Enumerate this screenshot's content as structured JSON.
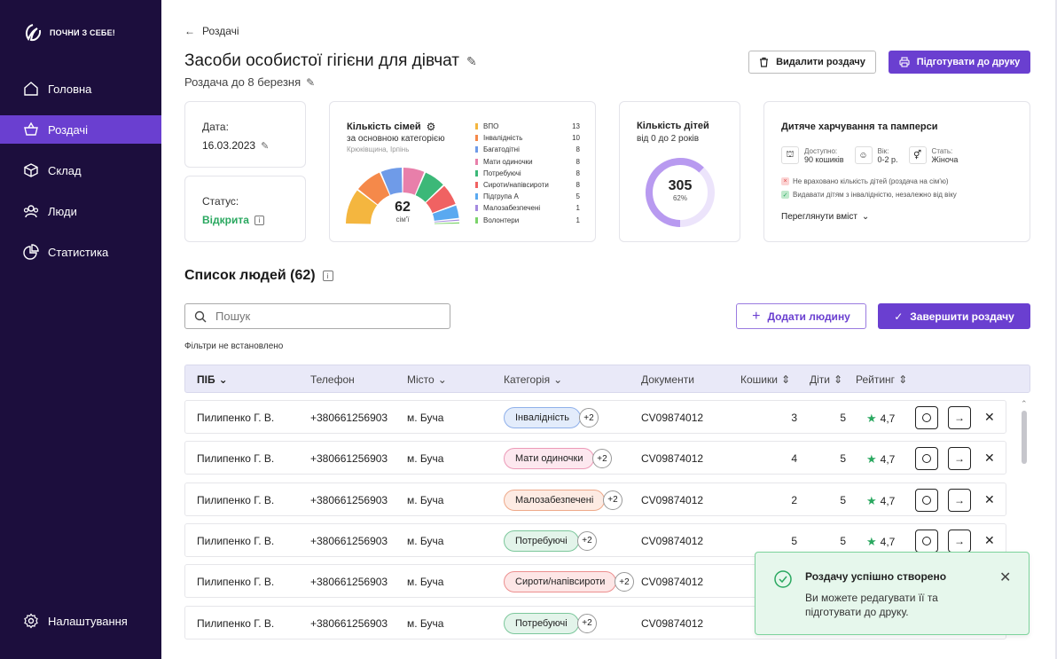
{
  "brand": "ПОЧНИ З СЕБЕ!",
  "nav": [
    {
      "label": "Головна",
      "icon": "home-icon"
    },
    {
      "label": "Роздачі",
      "icon": "basket-icon"
    },
    {
      "label": "Склад",
      "icon": "box-icon"
    },
    {
      "label": "Люди",
      "icon": "people-icon"
    },
    {
      "label": "Статистика",
      "icon": "pie-chart-icon"
    }
  ],
  "settings_label": "Налаштування",
  "back_label": "Роздачі",
  "title": "Засоби особистої гігієни для дівчат",
  "subtitle": "Роздача до 8 березня",
  "delete_label": "Видалити роздачу",
  "print_label": "Підготувати до друку",
  "date": {
    "label": "Дата:",
    "value": "16.03.2023"
  },
  "status": {
    "label": "Статус:",
    "value": "Відкрита"
  },
  "families": {
    "title": "Кількість сімей",
    "subtitle": "за основною категорією",
    "location": "Крюківщина, Ірпінь",
    "total": "62",
    "unit": "сім'ї",
    "legend": [
      {
        "name": "ВПО",
        "value": "13",
        "color": "#f4b63f"
      },
      {
        "name": "Інвалідність",
        "value": "10",
        "color": "#f5894a"
      },
      {
        "name": "Багатодітні",
        "value": "8",
        "color": "#6f9be8"
      },
      {
        "name": "Мати одиночки",
        "value": "8",
        "color": "#e87faa"
      },
      {
        "name": "Потребуючі",
        "value": "8",
        "color": "#3cb878"
      },
      {
        "name": "Сироти/напівсироти",
        "value": "8",
        "color": "#f06262"
      },
      {
        "name": "Підгрупа А",
        "value": "5",
        "color": "#5aa9f0"
      },
      {
        "name": "Малозабезпечені",
        "value": "1",
        "color": "#a58ae0"
      },
      {
        "name": "Волонтери",
        "value": "1",
        "color": "#7bd36a"
      }
    ]
  },
  "children": {
    "title": "Кількість дітей",
    "subtitle": "від 0 до 2 років",
    "value": "305",
    "percent": "62%",
    "fraction": 0.62
  },
  "baby": {
    "title": "Дитяче харчування та памперси",
    "available_label": "Доступно:",
    "available_value": "90 кошиків",
    "age_label": "Вік:",
    "age_value": "0-2 р.",
    "sex_label": "Стать:",
    "sex_value": "Жіноча",
    "note1": "Не враховано кількість дітей (роздача на сім'ю)",
    "note2": "Видавати дітям з інвалідністю, незалежно від віку",
    "view_label": "Переглянути вміст"
  },
  "list": {
    "title": "Список людей (62)",
    "search_placeholder": "Пошук",
    "filters": "Фільтри не встановлено",
    "add_label": "Додати людину",
    "finish_label": "Завершити роздачу"
  },
  "columns": [
    "ПІБ",
    "Телефон",
    "Місто",
    "Категорія",
    "Документи",
    "Кошики",
    "Діти",
    "Рейтинг"
  ],
  "rows": [
    {
      "name": "Пилипенко Г. В.",
      "phone": "+380661256903",
      "city": "м. Буча",
      "category": "Інвалідність",
      "more": "+2",
      "doc": "CV09874012",
      "baskets": "3",
      "kids": "5",
      "rating": "4,7",
      "bg": "#e3ecfb",
      "border": "#8fb0ea"
    },
    {
      "name": "Пилипенко Г. В.",
      "phone": "+380661256903",
      "city": "м. Буча",
      "category": "Мати одиночки",
      "more": "+2",
      "doc": "CV09874012",
      "baskets": "4",
      "kids": "5",
      "rating": "4,7",
      "bg": "#fde8ef",
      "border": "#ec9ab8"
    },
    {
      "name": "Пилипенко Г. В.",
      "phone": "+380661256903",
      "city": "м. Буча",
      "category": "Малозабезпечені",
      "more": "+2",
      "doc": "CV09874012",
      "baskets": "2",
      "kids": "5",
      "rating": "4,7",
      "bg": "#fdebe3",
      "border": "#eea98a"
    },
    {
      "name": "Пилипенко Г. В.",
      "phone": "+380661256903",
      "city": "м. Буча",
      "category": "Потребуючі",
      "more": "+2",
      "doc": "CV09874012",
      "baskets": "5",
      "kids": "5",
      "rating": "4,7",
      "bg": "#e3f4ea",
      "border": "#7bc79b"
    },
    {
      "name": "Пилипенко Г. В.",
      "phone": "+380661256903",
      "city": "м. Буча",
      "category": "Сироти/напівсироти",
      "more": "+2",
      "doc": "CV09874012",
      "baskets": "",
      "kids": "",
      "rating": "",
      "bg": "#fde6e6",
      "border": "#ec8f8f"
    },
    {
      "name": "Пилипенко Г. В.",
      "phone": "+380661256903",
      "city": "м. Буча",
      "category": "Потребуючі",
      "more": "+2",
      "doc": "CV09874012",
      "baskets": "",
      "kids": "",
      "rating": "",
      "bg": "#e3f4ea",
      "border": "#7bc79b"
    }
  ],
  "toast": {
    "title": "Роздачу успішно створено",
    "body": "Ви можете редагувати її та підготувати до друку."
  }
}
